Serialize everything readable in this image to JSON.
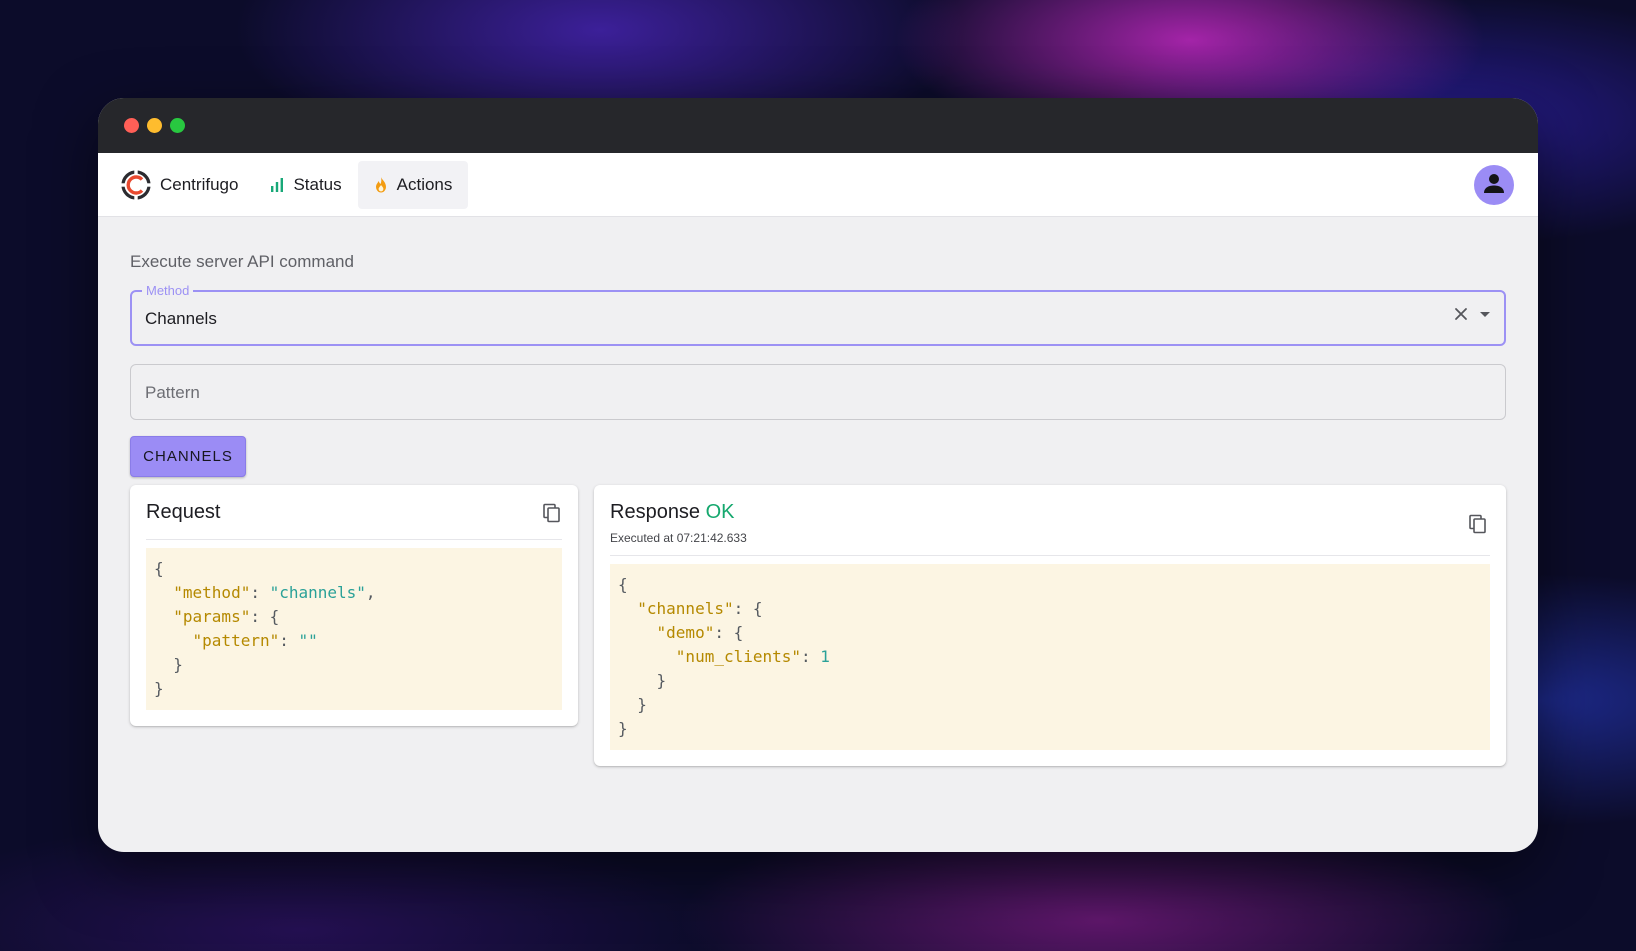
{
  "app": {
    "brand": "Centrifugo",
    "nav": [
      {
        "label": "Status",
        "icon": "bar-chart-icon"
      },
      {
        "label": "Actions",
        "icon": "fire-icon"
      }
    ],
    "active_nav": "Actions",
    "user_icon": "person-icon"
  },
  "main": {
    "title": "Execute server API command",
    "method_field": {
      "label": "Method",
      "value": "Channels"
    },
    "pattern_field": {
      "placeholder": "Pattern",
      "value": ""
    },
    "submit_label": "CHANNELS"
  },
  "request": {
    "title": "Request",
    "json": {
      "method": "channels",
      "params": {
        "pattern": ""
      }
    }
  },
  "response": {
    "title": "Response",
    "status": "OK",
    "executed_at": "Executed at 07:21:42.633",
    "json": {
      "channels": {
        "demo": {
          "num_clients": 1
        }
      }
    }
  },
  "colors": {
    "accent": "#9b8cf5",
    "status_ok": "#15a86e",
    "json_key": "#b58900",
    "json_string": "#2aa198",
    "code_bg": "#fcf5e3"
  }
}
